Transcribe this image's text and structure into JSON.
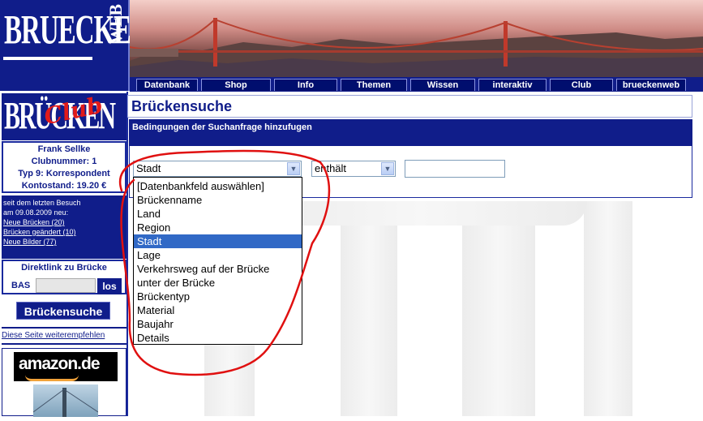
{
  "logo": {
    "word": "BRUECKEN",
    "side": "WEB"
  },
  "nav": {
    "tabs": [
      {
        "label": "Datenbank"
      },
      {
        "label": "Shop"
      },
      {
        "label": "Info"
      },
      {
        "label": "Themen"
      },
      {
        "label": "Wissen"
      },
      {
        "label": "interaktiv"
      },
      {
        "label": "Club"
      },
      {
        "label": "brueckenweb"
      }
    ]
  },
  "club_logo": {
    "word": "BRÜCKEN",
    "overlay": "Club",
    "side": "WEB"
  },
  "user": {
    "name": "Frank Sellke",
    "club_number": "Clubnummer: 1",
    "type": "Typ 9: Korrespondent",
    "balance": "Kontostand: 19.20 €"
  },
  "news": {
    "intro_line1": "seit dem letzten Besuch",
    "intro_line2": "am 09.08.2009 neu:",
    "links": [
      "Neue Brücken (20)",
      "Brücken geändert (10)",
      "Neue Bilder (77)"
    ]
  },
  "direct_link": {
    "title": "Direktlink zu Brücke",
    "prefix": "BAS",
    "button": "los"
  },
  "sidebar_search_button": "Brückensuche",
  "recommend_link": "Diese Seite weiterempfehlen",
  "amazon": {
    "label": "amazon.de"
  },
  "main": {
    "title": "Brückensuche",
    "conditions_header": "Bedingungen der Suchanfrage hinzufugen",
    "field_select_value": "Stadt",
    "operator_select_value": "enthält",
    "search_value": ""
  },
  "dropdown": {
    "options": [
      "[Datenbankfeld auswählen]",
      "Brückenname",
      "Land",
      "Region",
      "Stadt",
      "Lage",
      "Verkehrsweg auf der Brücke",
      "unter der Brücke",
      "Brückentyp",
      "Material",
      "Baujahr",
      "Details"
    ],
    "selected_index": 4
  },
  "colors": {
    "brand_blue": "#101d8a",
    "selection_blue": "#3169c6",
    "annotation_red": "#e01010"
  }
}
